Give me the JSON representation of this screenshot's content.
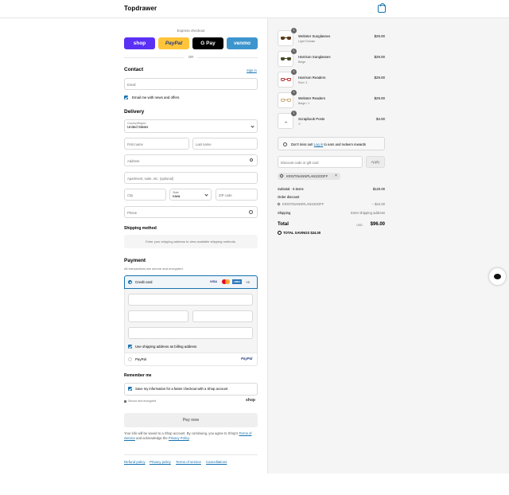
{
  "header": {
    "brand": "Topdrawer",
    "cart_icon": "shopping-bag-icon"
  },
  "express": {
    "title": "Express checkout",
    "shop": "shop",
    "paypal": "PayPal",
    "gpay": "G Pay",
    "venmo": "venmo",
    "or": "OR",
    "colors": {
      "shop": "#5a31f4",
      "paypal": "#ffc439",
      "gpay": "#000000",
      "venmo": "#3d95ce"
    }
  },
  "contact": {
    "title": "Contact",
    "signin": "Sign in",
    "email_placeholder": "Email",
    "news_label": "Email me with news and offers"
  },
  "delivery": {
    "title": "Delivery",
    "country_label": "Country/Region",
    "country_value": "United States",
    "first_name": "First name",
    "last_name": "Last name",
    "address": "Address",
    "apartment": "Apartment, suite, etc. (optional)",
    "city": "City",
    "state_label": "State",
    "state_value": "Iowa",
    "zip": "ZIP code",
    "phone": "Phone"
  },
  "shipping": {
    "title": "Shipping method",
    "note": "Enter your shipping address to view available shipping methods."
  },
  "payment": {
    "title": "Payment",
    "subtitle": "All transactions are secure and encrypted.",
    "credit_card": "Credit card",
    "visa": "VISA",
    "amex": "AMEX",
    "more": "+3",
    "billing_label": "Use shipping address as billing address",
    "paypal_option": "PayPal",
    "paypal_logo": "PayPal"
  },
  "remember": {
    "title": "Remember me",
    "label": "Save my information for a faster checkout with a Shop account",
    "secure": "Secure and encrypted",
    "shop": "shop"
  },
  "paynow": "Pay now",
  "disclaimer": {
    "text1": "Your info will be saved to a Shop account. By continuing, you agree to Shop's",
    "terms": "Terms of Service",
    "text2": "and acknowledge the",
    "privacy": "Privacy Policy",
    "end": "."
  },
  "footer": {
    "refund": "Refund policy",
    "privacy": "Privacy policy",
    "terms": "Terms of service",
    "cancellations": "Cancellations"
  },
  "items": [
    {
      "name": "Webster Sunglasses",
      "variant": "Light Tortoise",
      "price": "$29.00",
      "qty": "1"
    },
    {
      "name": "Harrison Sunglasses",
      "variant": "Beige",
      "price": "$29.00",
      "qty": "1"
    },
    {
      "name": "Harrison Readers",
      "variant": "Red / 1",
      "price": "$29.00",
      "qty": "1"
    },
    {
      "name": "Webster Readers",
      "variant": "Beige / 1",
      "price": "$29.00",
      "qty": "1"
    },
    {
      "name": "Scrapbook Posts",
      "variant": "1\"",
      "price": "$4.00",
      "qty": "1"
    }
  ],
  "rewards": {
    "text1": "Don't miss out!",
    "login": "Log in",
    "text2": "to earn and redeem rewards"
  },
  "discount": {
    "placeholder": "Discount code or gift card",
    "apply": "Apply",
    "code": "KRISTINANNPLANS20OFF"
  },
  "summary": {
    "subtotal_label": "Subtotal · 5 items",
    "subtotal": "$120.00",
    "order_discount": "Order discount",
    "code": "KRISTINANNPLANS20OFF",
    "discount": "– $24.00",
    "shipping_label": "Shipping",
    "shipping_value": "Enter shipping address",
    "total_label": "Total",
    "currency": "USD",
    "total": "$96.00",
    "savings_label": "TOTAL SAVINGS",
    "savings": "$24.00"
  }
}
